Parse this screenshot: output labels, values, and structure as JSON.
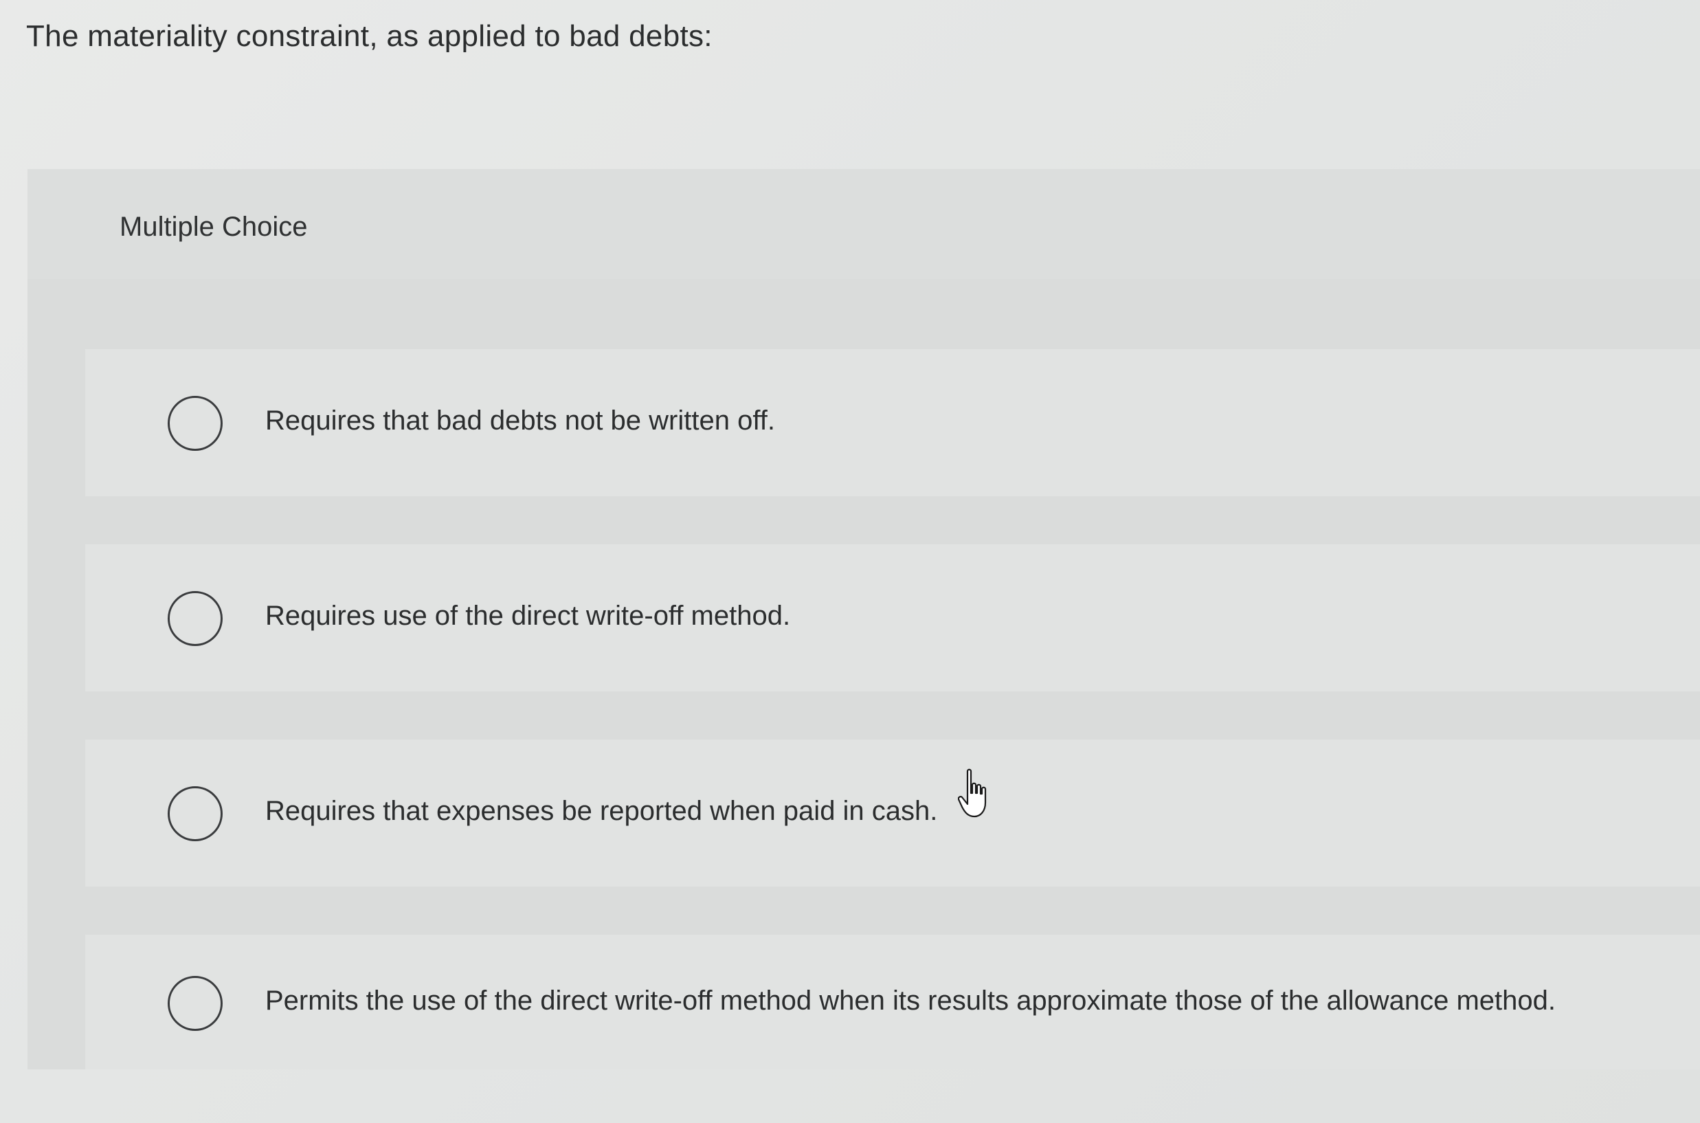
{
  "question": {
    "prompt": "The materiality constraint, as applied to bad debts:"
  },
  "multiple_choice": {
    "label": "Multiple Choice",
    "options": [
      {
        "text": "Requires that bad debts not be written off.",
        "selected": false
      },
      {
        "text": "Requires use of the direct write-off method.",
        "selected": false
      },
      {
        "text": "Requires that expenses be reported when paid in cash.",
        "selected": false
      },
      {
        "text": "Permits the use of the direct write-off method when its results approximate those of the allowance method.",
        "selected": false
      }
    ]
  },
  "cursor": {
    "icon": "hand-pointer-icon"
  },
  "colors": {
    "page_background": "#e4e6e5",
    "panel_background": "#dadcdb",
    "option_background": "#e1e3e2",
    "text": "#2b2d2e",
    "radio_border": "#3a3c3e"
  }
}
